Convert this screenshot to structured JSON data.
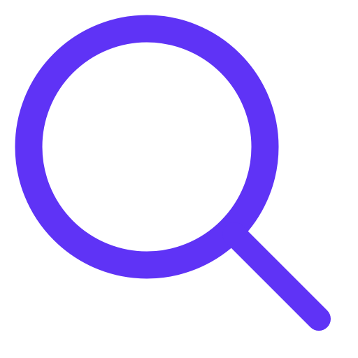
{
  "icon": {
    "name": "search-icon",
    "color": "#5f33f6",
    "background": "#ffffff"
  }
}
